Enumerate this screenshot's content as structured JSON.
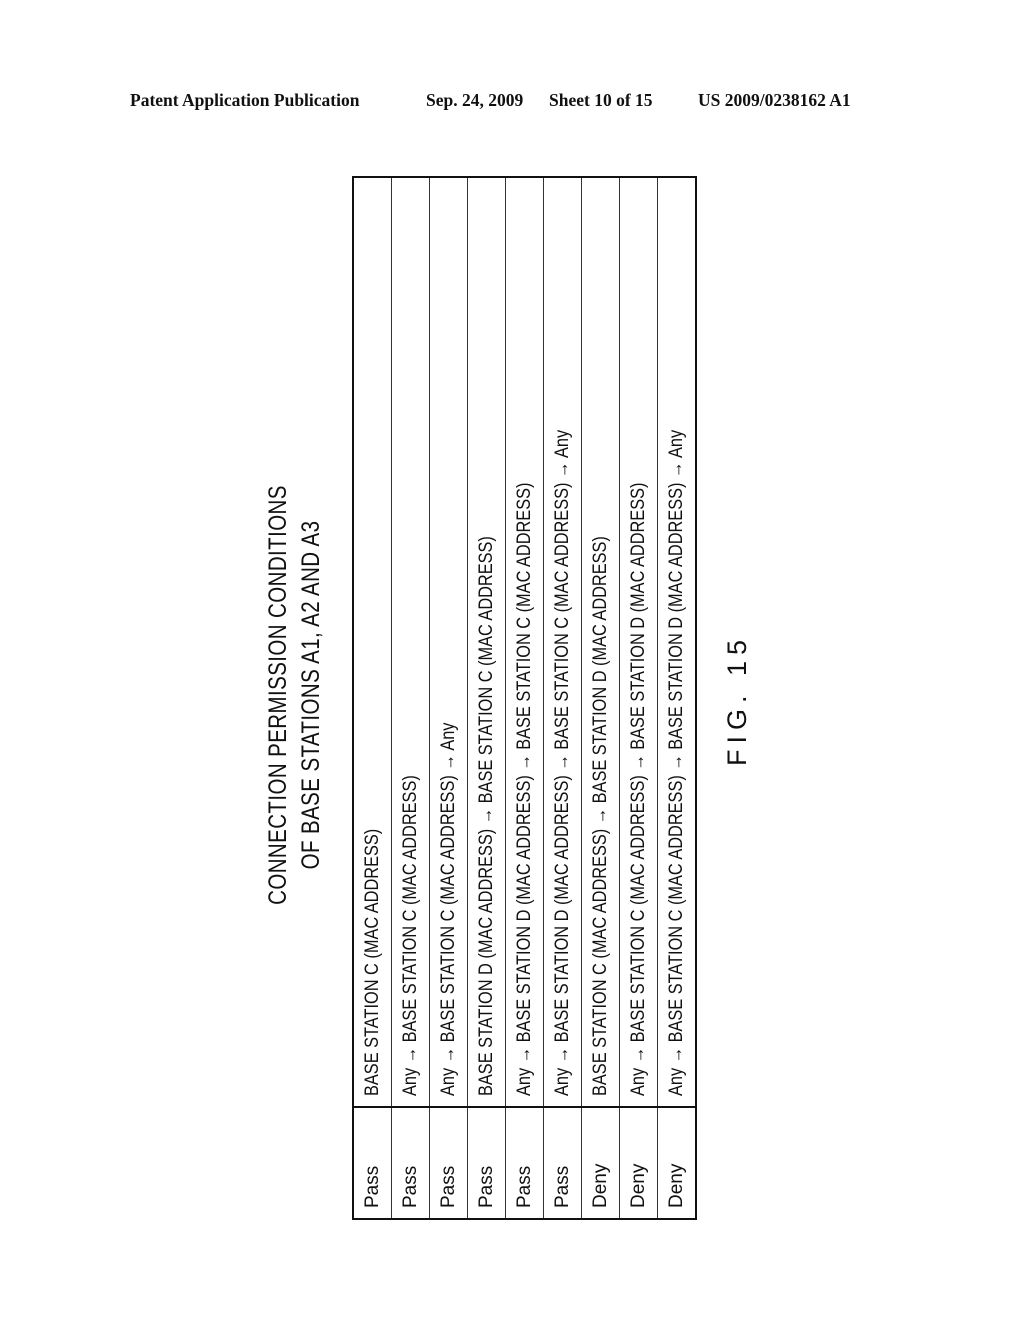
{
  "header": {
    "publication": "Patent Application Publication",
    "date": "Sep. 24, 2009",
    "sheet": "Sheet 10 of 15",
    "number": "US 2009/0238162 A1"
  },
  "figure": {
    "title_line1": "CONNECTION PERMISSION CONDITIONS",
    "title_line2": "OF BASE STATIONS A1, A2 AND A3",
    "label": "FIG. 15"
  },
  "rules": [
    {
      "action": "Pass",
      "condition": "BASE STATION C (MAC ADDRESS)"
    },
    {
      "action": "Pass",
      "condition": "Any → BASE STATION C (MAC ADDRESS)"
    },
    {
      "action": "Pass",
      "condition": "Any → BASE STATION C (MAC ADDRESS) → Any"
    },
    {
      "action": "Pass",
      "condition": "BASE STATION D (MAC ADDRESS) → BASE STATION C (MAC ADDRESS)"
    },
    {
      "action": "Pass",
      "condition": "Any → BASE STATION D (MAC ADDRESS) → BASE STATION C (MAC ADDRESS)"
    },
    {
      "action": "Pass",
      "condition": "Any → BASE STATION D (MAC ADDRESS) → BASE STATION C (MAC ADDRESS) → Any"
    },
    {
      "action": "Deny",
      "condition": "BASE STATION C (MAC ADDRESS) → BASE STATION D (MAC ADDRESS)"
    },
    {
      "action": "Deny",
      "condition": "Any → BASE STATION C (MAC ADDRESS) → BASE STATION D (MAC ADDRESS)"
    },
    {
      "action": "Deny",
      "condition": "Any → BASE STATION C (MAC ADDRESS) → BASE STATION D (MAC ADDRESS) → Any"
    }
  ]
}
